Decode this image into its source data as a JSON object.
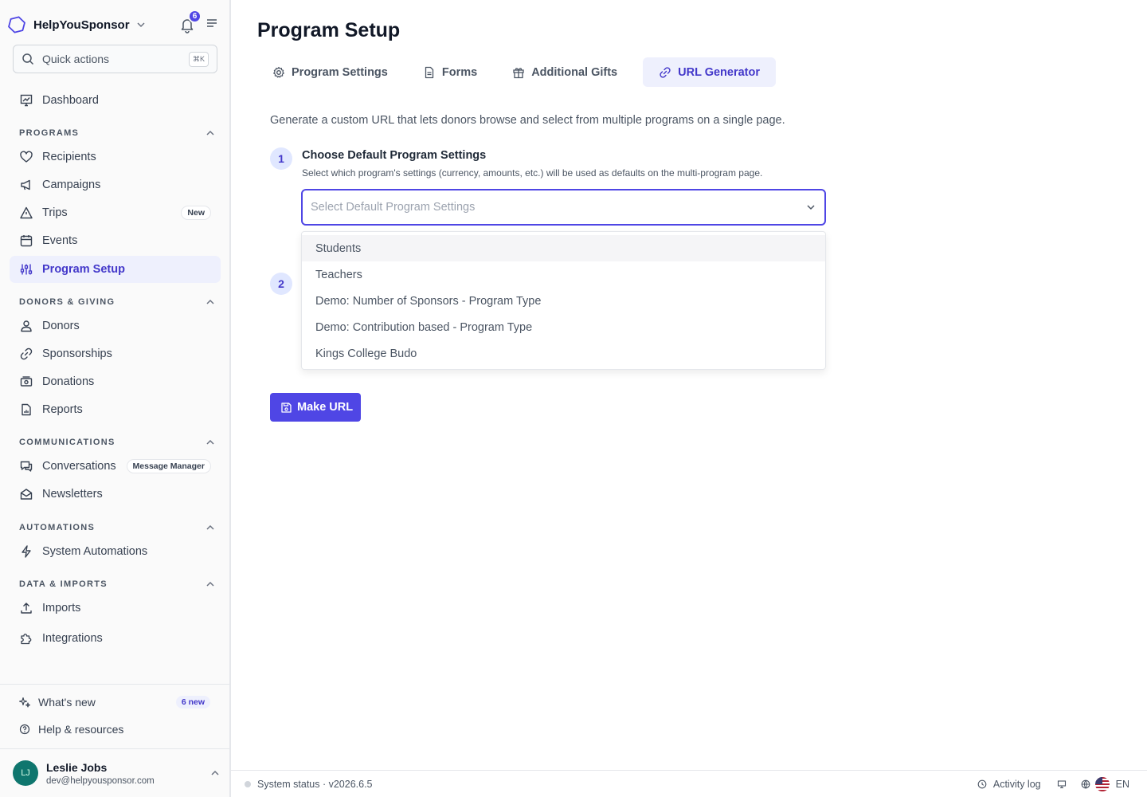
{
  "app": {
    "org_name": "HelpYouSponsor",
    "notification_count": "6"
  },
  "quick_actions": {
    "label": "Quick actions",
    "shortcut": "⌘K"
  },
  "nav": {
    "dashboard": "Dashboard",
    "programs_heading": "PROGRAMS",
    "recipients": "Recipients",
    "campaigns": "Campaigns",
    "trips": "Trips",
    "trips_badge": "New",
    "events": "Events",
    "program_setup": "Program Setup",
    "donors_heading": "DONORS & GIVING",
    "donors": "Donors",
    "sponsorships": "Sponsorships",
    "donations": "Donations",
    "reports": "Reports",
    "communications_heading": "COMMUNICATIONS",
    "conversations": "Conversations",
    "conversations_badge": "Message Manager",
    "newsletters": "Newsletters",
    "automations_heading": "AUTOMATIONS",
    "system_automations": "System Automations",
    "data_heading": "DATA & IMPORTS",
    "imports": "Imports",
    "integrations": "Integrations"
  },
  "sidebar_footer": {
    "whats_new": "What's new",
    "whats_new_badge": "6 new",
    "help": "Help & resources"
  },
  "user": {
    "initials": "LJ",
    "name": "Leslie Jobs",
    "email": "dev@helpyousponsor.com"
  },
  "page": {
    "title": "Program Setup",
    "tabs": {
      "program_settings": "Program Settings",
      "forms": "Forms",
      "additional_gifts": "Additional Gifts",
      "url_generator": "URL Generator"
    },
    "intro": "Generate a custom URL that lets donors browse and select from multiple programs on a single page.",
    "step1": {
      "number": "1",
      "title": "Choose Default Program Settings",
      "description": "Select which program's settings (currency, amounts, etc.) will be used as defaults on the multi-program page."
    },
    "step2": {
      "number": "2"
    },
    "select": {
      "placeholder": "Select Default Program Settings",
      "options": [
        "Students",
        "Teachers",
        "Demo: Number of Sponsors - Program Type",
        "Demo: Contribution based - Program Type",
        "Kings College Budo"
      ]
    },
    "make_url_button": "Make URL"
  },
  "bottom_bar": {
    "status": "System status · v2026.6.5",
    "activity_log": "Activity log",
    "language": "EN"
  },
  "colors": {
    "accent": "#4f46e5",
    "accent_soft": "#eef0fd",
    "avatar": "#0f766e"
  }
}
